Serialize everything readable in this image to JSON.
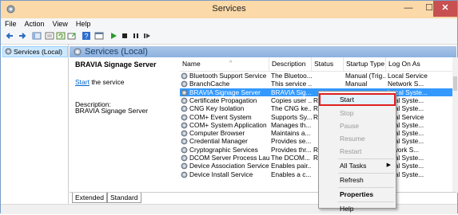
{
  "window": {
    "title": "Services",
    "min": "—",
    "max": "☐",
    "close": "✕"
  },
  "menu": [
    "File",
    "Action",
    "View",
    "Help"
  ],
  "toolbar_icons": [
    "back-icon",
    "forward-icon",
    "show-tree-icon",
    "properties-icon",
    "refresh-icon",
    "export-icon",
    "help-icon",
    "console-icon",
    "start-icon",
    "stop-icon",
    "pause-icon",
    "restart-icon"
  ],
  "tree": {
    "item": "Services (Local)"
  },
  "header": {
    "label": "Services (Local)"
  },
  "description": {
    "service_name": "BRAVIA Signage Server",
    "link_text": "Start",
    "link_suffix": " the service",
    "desc_label": "Description:",
    "desc_value": "BRAVIA Signage Server"
  },
  "table": {
    "columns": [
      "Name",
      "Description",
      "Status",
      "Startup Type",
      "Log On As"
    ],
    "rows": [
      [
        "Bluetooth Support Service",
        "The Bluetoo...",
        "",
        "Manual (Trig...",
        "Local Service"
      ],
      [
        "BranchCache",
        "This service ...",
        "",
        "Manual",
        "Network S..."
      ],
      [
        "BRAVIA Signage Server",
        "BRAVIA Sig...",
        "",
        "",
        "Local Syste..."
      ],
      [
        "Certificate Propagation",
        "Copies user ...",
        "Ru",
        "",
        "ocal Syste..."
      ],
      [
        "CNG Key Isolation",
        "The CNG ke...",
        "Ru",
        "",
        "ocal Syste..."
      ],
      [
        "COM+ Event System",
        "Supports Sy...",
        "Ru",
        "",
        "ocal Service"
      ],
      [
        "COM+ System Application",
        "Manages th...",
        "",
        "",
        "ocal Syste..."
      ],
      [
        "Computer Browser",
        "Maintains a...",
        "",
        "",
        "ocal Syste..."
      ],
      [
        "Credential Manager",
        "Provides se...",
        "",
        "",
        "ocal Syste..."
      ],
      [
        "Cryptographic Services",
        "Provides thr...",
        "Ru",
        "",
        "etwork S..."
      ],
      [
        "DCOM Server Process Laun...",
        "The DCOM...",
        "Ru",
        "",
        "ocal Syste..."
      ],
      [
        "Device Association Service",
        "Enables pair...",
        "",
        "",
        "ocal Syste..."
      ],
      [
        "Device Install Service",
        "Enables a c...",
        "",
        "",
        "ocal Syste..."
      ]
    ],
    "selected_row": 2
  },
  "tabs": [
    "Extended",
    "Standard"
  ],
  "context_menu": {
    "items": [
      {
        "label": "Start",
        "enabled": true
      },
      {
        "label": "Stop",
        "enabled": false
      },
      {
        "label": "Pause",
        "enabled": false
      },
      {
        "label": "Resume",
        "enabled": false
      },
      {
        "label": "Restart",
        "enabled": false
      },
      {
        "label": "All Tasks",
        "enabled": true,
        "submenu": true
      },
      {
        "label": "Refresh",
        "enabled": true
      },
      {
        "label": "Properties",
        "enabled": true,
        "bold": true
      },
      {
        "label": "Help",
        "enabled": true
      }
    ]
  },
  "colors": {
    "titlebar": "#fbd9a8",
    "selection": "#3399ff",
    "close": "#c75050",
    "highlight_box": "#e02020",
    "link": "#0066cc"
  }
}
